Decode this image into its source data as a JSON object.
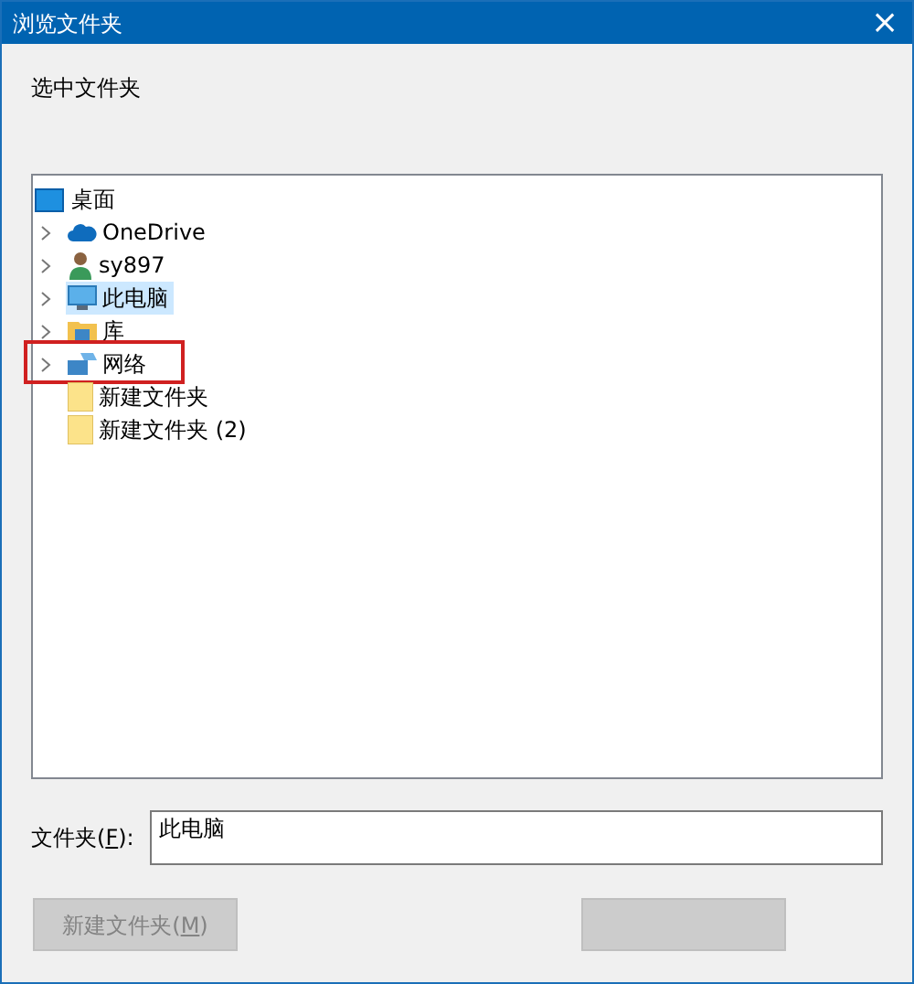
{
  "window": {
    "title": "浏览文件夹",
    "close": "×"
  },
  "instruction": "选中文件夹",
  "tree": {
    "label": "桌面",
    "kind": "desktop",
    "children": [
      {
        "label": "OneDrive",
        "kind": "cloud",
        "has_children": true,
        "selected": false,
        "highlighted": false
      },
      {
        "label": "sy897",
        "kind": "user",
        "has_children": true,
        "selected": false,
        "highlighted": false
      },
      {
        "label": "此电脑",
        "kind": "pc",
        "has_children": true,
        "selected": true,
        "highlighted": false
      },
      {
        "label": "库",
        "kind": "library",
        "has_children": true,
        "selected": false,
        "highlighted": false
      },
      {
        "label": "网络",
        "kind": "network",
        "has_children": true,
        "selected": false,
        "highlighted": true
      },
      {
        "label": "新建文件夹",
        "kind": "folder",
        "has_children": false,
        "selected": false,
        "highlighted": false
      },
      {
        "label": "新建文件夹 (2)",
        "kind": "folder",
        "has_children": false,
        "selected": false,
        "highlighted": false
      }
    ]
  },
  "folder_field": {
    "label_parts": [
      "文件夹(",
      "F",
      "):"
    ],
    "value": "此电脑"
  },
  "buttons": [
    {
      "kind": "new",
      "label_parts": [
        "新建文件夹(",
        "M",
        ")"
      ],
      "disabled": true
    },
    {
      "kind": "ok",
      "disabled": true
    }
  ]
}
